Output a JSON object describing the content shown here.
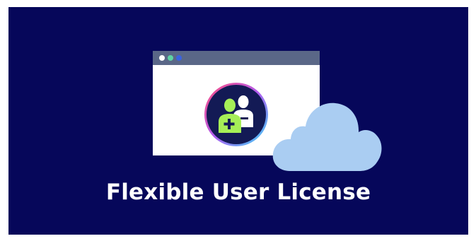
{
  "heading": {
    "title": "Flexible User License"
  },
  "colors": {
    "background": "#06075a",
    "window_bar": "#5a6787",
    "window_body": "#ffffff",
    "dot_1": "#ffffff",
    "dot_2": "#5ed3a4",
    "dot_3": "#3b63e0",
    "badge_fill": "#131a55",
    "user_add": "#a6ef57",
    "user_existing": "#ffffff",
    "cloud": "#aacdf2"
  },
  "icons": {
    "window": "browser-window-icon",
    "badge": "add-user-icon",
    "cloud": "cloud-icon"
  }
}
